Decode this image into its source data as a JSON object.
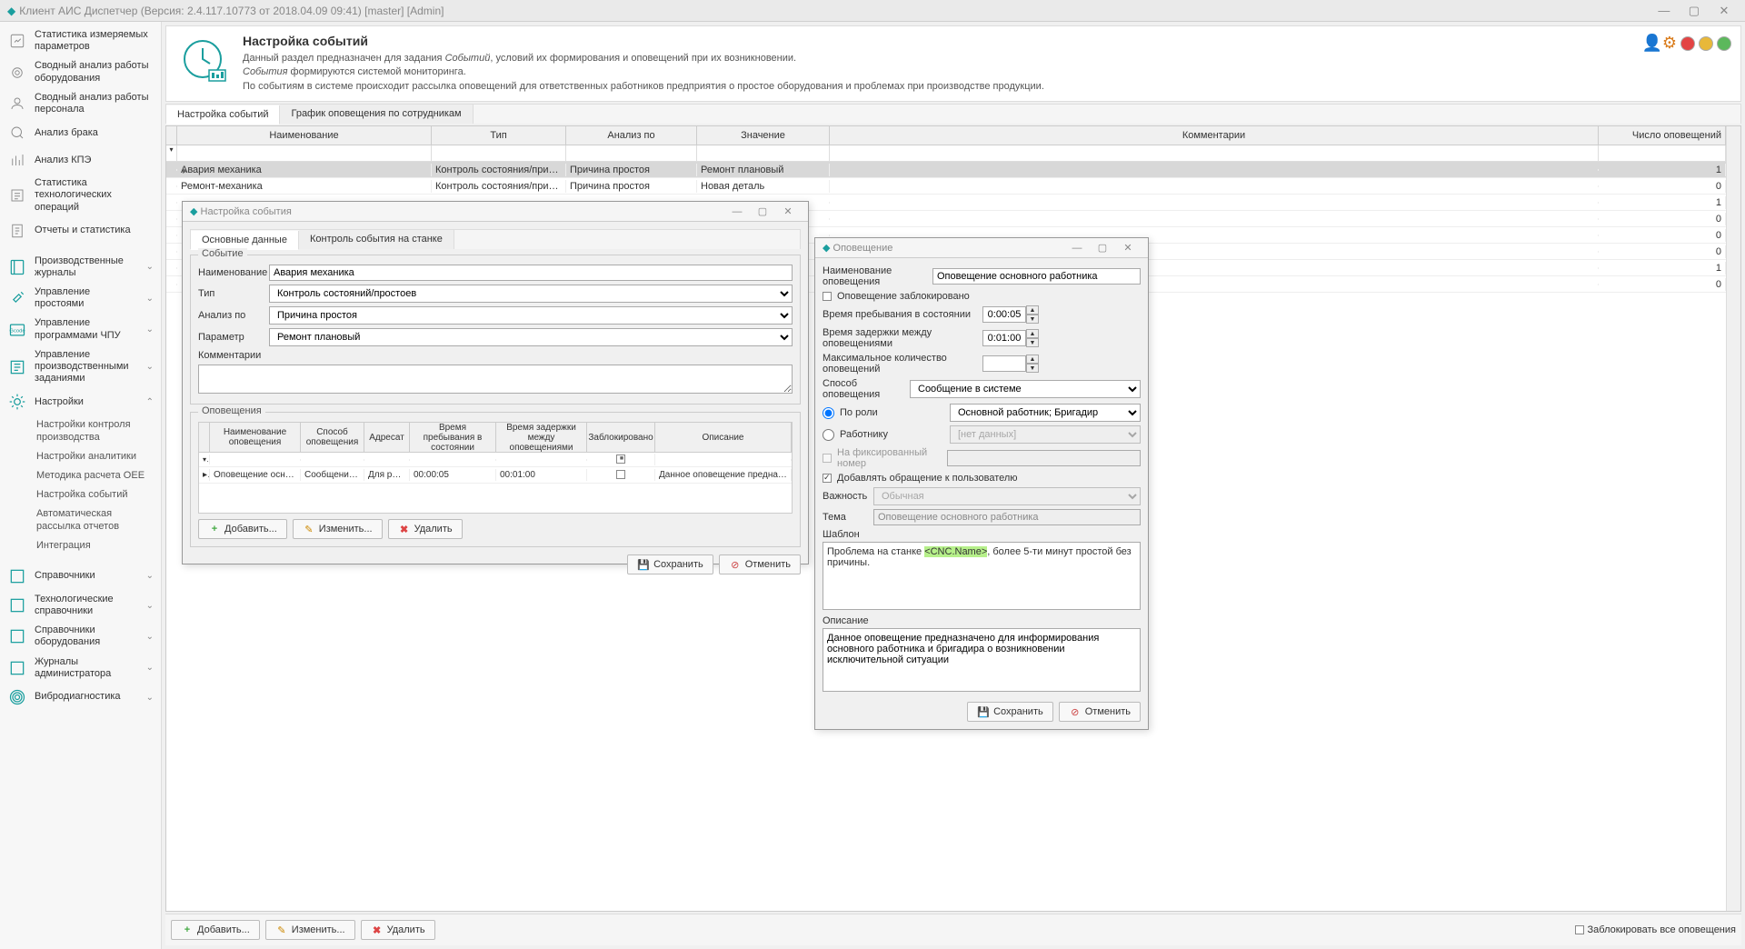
{
  "window": {
    "title": "Клиент АИС Диспетчер (Версия: 2.4.117.10773 от 2018.04.09 09:41) [master]  [Admin]"
  },
  "sidebar": {
    "items": [
      {
        "label": "Статистика измеряемых параметров",
        "type": "plain"
      },
      {
        "label": "Сводный анализ работы оборудования",
        "type": "plain"
      },
      {
        "label": "Сводный анализ работы персонала",
        "type": "plain"
      },
      {
        "label": "Анализ брака",
        "type": "plain"
      },
      {
        "label": "Анализ КПЭ",
        "type": "plain"
      },
      {
        "label": "Статистика технологических операций",
        "type": "plain"
      },
      {
        "label": "Отчеты и статистика",
        "type": "plain"
      },
      {
        "label": "Производственные журналы",
        "type": "group"
      },
      {
        "label": "Управление простоями",
        "type": "group"
      },
      {
        "label": "Управление программами ЧПУ",
        "type": "group"
      },
      {
        "label": "Управление производственными заданиями",
        "type": "group"
      },
      {
        "label": "Настройки",
        "type": "group-open"
      },
      {
        "label": "Настройки контроля производства",
        "type": "sub"
      },
      {
        "label": "Настройки аналитики",
        "type": "sub"
      },
      {
        "label": "Методика расчета OEE",
        "type": "sub"
      },
      {
        "label": "Настройка событий",
        "type": "sub"
      },
      {
        "label": "Автоматическая рассылка отчетов",
        "type": "sub"
      },
      {
        "label": "Интеграция",
        "type": "sub"
      },
      {
        "label": "Справочники",
        "type": "group"
      },
      {
        "label": "Технологические справочники",
        "type": "group"
      },
      {
        "label": "Справочники оборудования",
        "type": "group"
      },
      {
        "label": "Журналы администратора",
        "type": "group"
      },
      {
        "label": "Вибродиагностика",
        "type": "group"
      }
    ]
  },
  "header": {
    "title": "Настройка событий",
    "line1a": "Данный раздел предназначен для задания ",
    "line1b": "Событий",
    "line1c": ", условий их формирования и оповещений при их возникновении.",
    "line2a": "События",
    "line2b": " формируются системой мониторинга.",
    "line3": "По событиям в системе происходит рассылка оповещений для ответственных работников предприятия о простое оборудования и проблемах при производстве продукции."
  },
  "tabs": {
    "main": [
      "Настройка событий",
      "График оповещения по сотрудникам"
    ]
  },
  "grid": {
    "columns": [
      "Наименование",
      "Тип",
      "Анализ по",
      "Значение",
      "Комментарии",
      "Число оповещений"
    ],
    "rows": [
      {
        "name": "Авария механика",
        "type": "Контроль состояния/причины п...",
        "analyze": "Причина простоя",
        "value": "Ремонт плановый",
        "comment": "",
        "count": "1",
        "selected": true
      },
      {
        "name": "Ремонт-механика",
        "type": "Контроль состояния/причины п...",
        "analyze": "Причина простоя",
        "value": "Новая деталь",
        "comment": "",
        "count": "0"
      },
      {
        "count": "1"
      },
      {
        "count": "0"
      },
      {
        "count": "0"
      },
      {
        "count": "0"
      },
      {
        "count": "1"
      },
      {
        "count": "0"
      }
    ]
  },
  "eventDialog": {
    "title": "Настройка события",
    "tabs": [
      "Основные данные",
      "Контроль события на станке"
    ],
    "group1": "Событие",
    "labels": {
      "name": "Наименование",
      "type": "Тип",
      "analyze": "Анализ по",
      "param": "Параметр",
      "comment": "Комментарии"
    },
    "values": {
      "name": "Авария механика",
      "type": "Контроль состояний/простоев",
      "analyze": "Причина простоя",
      "param": "Ремонт плановый",
      "comment": ""
    },
    "group2": "Оповещения",
    "notifGrid": {
      "columns": [
        "Наименование оповещения",
        "Способ оповещения",
        "Адресат",
        "Время пребывания в состоянии",
        "Время задержки между оповещениями",
        "Заблокировано",
        "Описание"
      ],
      "row": {
        "name": "Оповещение основ...",
        "method": "Сообщение в ...",
        "addr": "Для рол...",
        "time1": "00:00:05",
        "time2": "00:01:00",
        "blocked": false,
        "desc": "Данное оповещение предназн..."
      }
    },
    "buttons": {
      "add": "Добавить...",
      "edit": "Изменить...",
      "delete": "Удалить",
      "save": "Сохранить",
      "cancel": "Отменить"
    }
  },
  "notifDialog": {
    "title": "Оповещение",
    "labels": {
      "name": "Наименование оповещения",
      "blocked": "Оповещение заблокировано",
      "stay": "Время пребывания в состоянии",
      "delay": "Время задержки между оповещениями",
      "max": "Максимальное количество оповещений",
      "method": "Способ оповещения",
      "byRole": "По роли",
      "byWorker": "Работнику",
      "fixedNum": "На фиксированный номер",
      "addAppeal": "Добавлять обращение к пользователю",
      "priority": "Важность",
      "theme": "Тема",
      "template": "Шаблон",
      "desc": "Описание"
    },
    "values": {
      "name": "Оповещение основного работника",
      "stay": "0:00:05",
      "delay": "0:01:00",
      "max": "",
      "method": "Сообщение в системе",
      "role": "Основной работник; Бригадир",
      "worker": "[нет данных]",
      "fixedNum": "",
      "priority": "Обычная",
      "theme": "Оповещение основного работника",
      "templatePre": "Проблема на станке ",
      "templateTag": "<CNC.Name>",
      "templatePost": ", более 5-ти минут простой без причины.",
      "desc": "Данное оповещение предназначено для информирования основного работника и бригадира о возникновении исключительной ситуации"
    },
    "buttons": {
      "save": "Сохранить",
      "cancel": "Отменить"
    }
  },
  "bottomBar": {
    "add": "Добавить...",
    "edit": "Изменить...",
    "delete": "Удалить",
    "blockAll": "Заблокировать все оповещения"
  }
}
